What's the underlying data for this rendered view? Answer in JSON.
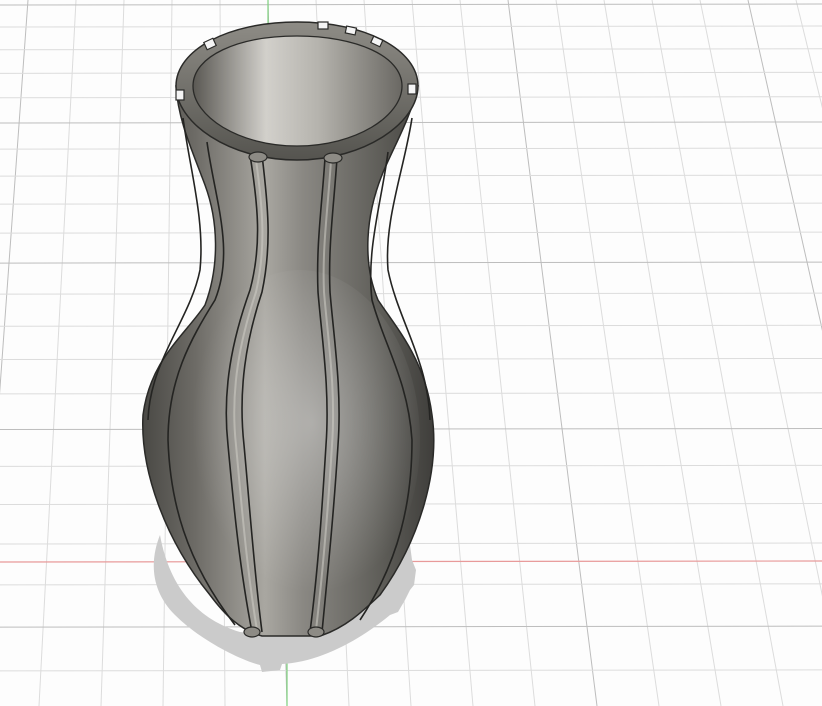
{
  "viewport": {
    "background": "#fdfdfd",
    "grid": {
      "visible": true,
      "minor_color": "#dcdcdc",
      "major_color": "#bdbdbd"
    },
    "axes": {
      "x_axis_color": "#e89a9a",
      "y_axis_color": "#7fd27f"
    }
  },
  "model": {
    "type": "fluted-vase",
    "body_color": "#6f6d67",
    "highlight_color": "#b9b7b1",
    "edge_color": "#2a2a28",
    "shadow_color": "#c9c9c9"
  }
}
